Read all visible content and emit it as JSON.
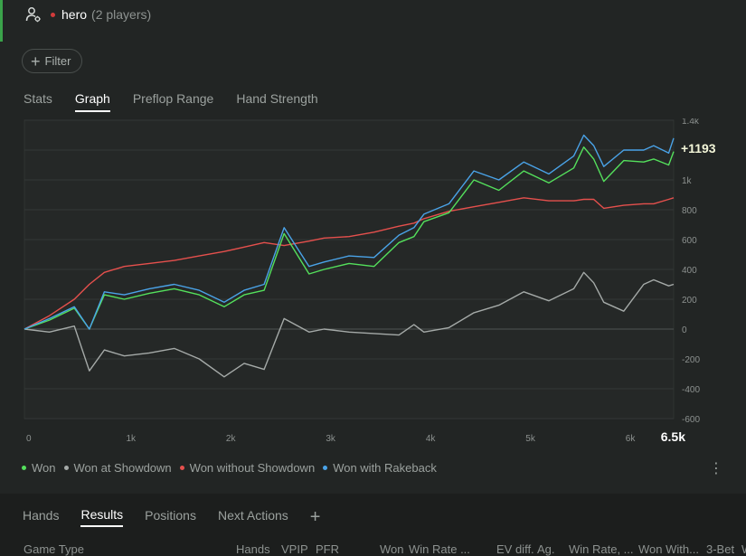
{
  "header": {
    "hero": "hero",
    "players": "(2 players)"
  },
  "filter": {
    "label": "Filter"
  },
  "tabs": [
    "Stats",
    "Graph",
    "Preflop Range",
    "Hand Strength"
  ],
  "active_tab": "Graph",
  "chart_data": {
    "type": "line",
    "current_value_label": "+1193",
    "x_end_label": "6.5k",
    "xlim": [
      0,
      6500
    ],
    "ylim": [
      -600,
      1400
    ],
    "x_ticks": [
      "0",
      "1k",
      "2k",
      "3k",
      "4k",
      "5k",
      "6k"
    ],
    "y_ticks": [
      "1.4k",
      "1k",
      "800",
      "600",
      "400",
      "200",
      "0",
      "-200",
      "-400",
      "-600"
    ],
    "grid": true,
    "legend_position": "bottom-left",
    "x": [
      0,
      250,
      500,
      650,
      800,
      1000,
      1250,
      1500,
      1750,
      2000,
      2200,
      2400,
      2600,
      2850,
      3000,
      3250,
      3500,
      3750,
      3900,
      4000,
      4250,
      4500,
      4750,
      5000,
      5250,
      5500,
      5600,
      5700,
      5800,
      6000,
      6200,
      6300,
      6450,
      6500
    ],
    "series": [
      {
        "name": "Won",
        "color": "#54e05c",
        "values": [
          0,
          60,
          140,
          0,
          230,
          200,
          240,
          270,
          230,
          150,
          230,
          260,
          640,
          370,
          400,
          440,
          420,
          580,
          620,
          720,
          780,
          1000,
          930,
          1060,
          980,
          1080,
          1220,
          1140,
          990,
          1130,
          1120,
          1140,
          1100,
          1190
        ]
      },
      {
        "name": "Won at Showdown",
        "color": "#a5aaa8",
        "values": [
          0,
          -20,
          20,
          -280,
          -140,
          -180,
          -160,
          -130,
          -200,
          -320,
          -230,
          -270,
          70,
          -20,
          0,
          -20,
          -30,
          -40,
          30,
          -20,
          10,
          110,
          160,
          250,
          190,
          270,
          380,
          310,
          180,
          120,
          300,
          330,
          290,
          300
        ]
      },
      {
        "name": "Won without Showdown",
        "color": "#e5504d",
        "values": [
          0,
          90,
          200,
          300,
          380,
          420,
          440,
          460,
          490,
          520,
          550,
          580,
          560,
          590,
          610,
          620,
          650,
          690,
          710,
          740,
          790,
          820,
          850,
          880,
          860,
          860,
          870,
          870,
          810,
          830,
          840,
          840,
          870,
          880
        ]
      },
      {
        "name": "Won with Rakeback",
        "color": "#4aa3e8",
        "values": [
          0,
          70,
          150,
          0,
          250,
          230,
          270,
          300,
          260,
          180,
          260,
          300,
          680,
          420,
          450,
          490,
          480,
          630,
          680,
          770,
          840,
          1060,
          1000,
          1120,
          1040,
          1160,
          1300,
          1230,
          1090,
          1200,
          1200,
          1230,
          1180,
          1280
        ]
      }
    ]
  },
  "bottom_tabs": [
    "Hands",
    "Results",
    "Positions",
    "Next Actions"
  ],
  "bottom_active_tab": "Results",
  "table_columns": [
    "Game Type",
    "Hands",
    "VPIP",
    "PFR",
    "Won",
    "Win Rate ...",
    "EV diff.",
    "Ag.",
    "Win Rate, ...",
    "Won With...",
    "3-Bet",
    "W"
  ]
}
